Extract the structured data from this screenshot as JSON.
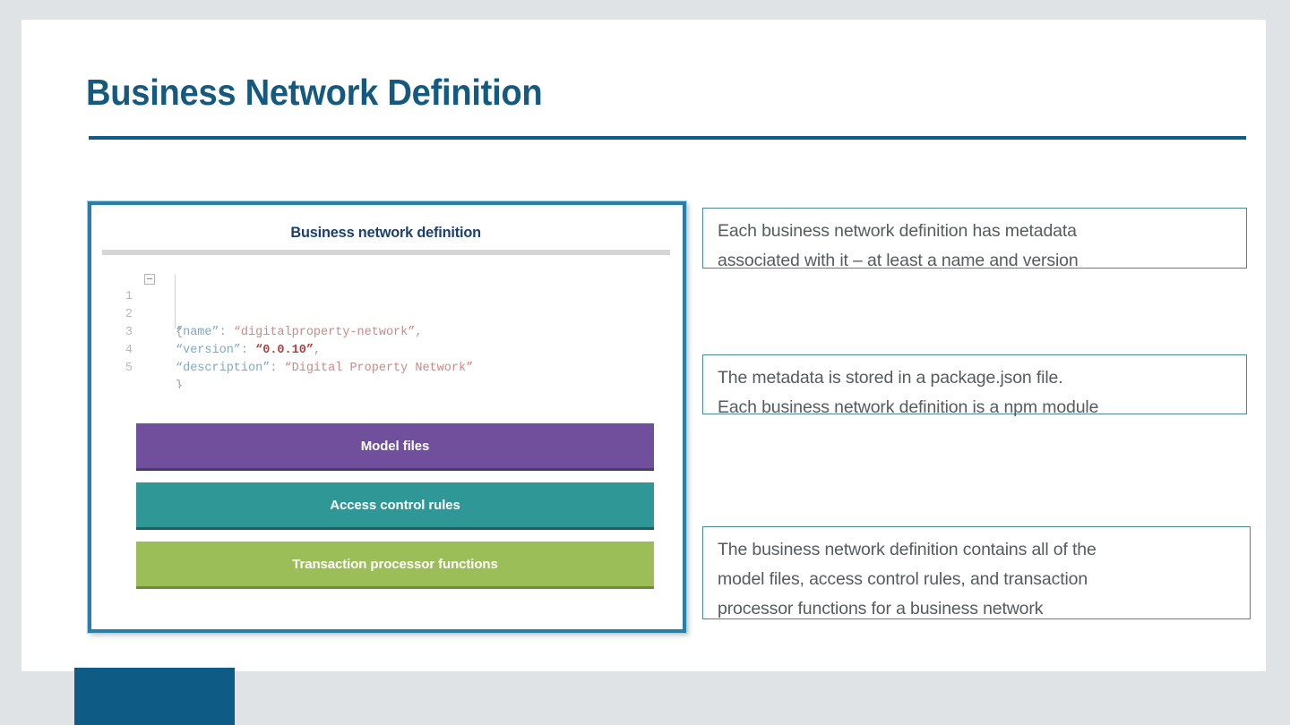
{
  "slide": {
    "title": "Business Network Definition",
    "background_color": "#dfe3e5",
    "surface_color": "#ffffff",
    "accent_color": "#105a83",
    "footer_accent_color": "#0e5b86"
  },
  "diagram": {
    "frame_border_color": "#2a7fa8",
    "card_header": "Business network definition",
    "code": {
      "language": "json",
      "line_numbers": [
        "1",
        "2",
        "3",
        "4",
        "5"
      ],
      "fold_icon": "collapse-minus-icon",
      "lines": [
        {
          "n": "1",
          "open_brace": "{"
        },
        {
          "n": "2",
          "key": "“name”",
          "colon": ": ",
          "value": "“digitalproperty-network”",
          "comma": ","
        },
        {
          "n": "3",
          "key": "“version”",
          "colon": ": ",
          "value": "“0.0.10”",
          "comma": ","
        },
        {
          "n": "4",
          "key": "“description”",
          "colon": ": ",
          "value": "“Digital Property Network”",
          "comma": ""
        },
        {
          "n": "5",
          "close_brace": "}"
        }
      ],
      "key_color": "#7fa8c6",
      "string_color": "#c98a86",
      "version_color": "#b0413e"
    },
    "bars": [
      {
        "label": "Model files",
        "color": "#70509c"
      },
      {
        "label": "Access control rules",
        "color": "#2f9796"
      },
      {
        "label": "Transaction processor functions",
        "color": "#9cbe58"
      }
    ]
  },
  "callouts": [
    {
      "line1": "Each business network definition has metadata",
      "line2": "associated with it – at least a name and version",
      "line3": ""
    },
    {
      "line1": "The metadata is stored in a package.json file.",
      "line2": "Each business network definition is a npm module",
      "line3": ""
    },
    {
      "line1": "The business network definition contains all of the",
      "line2": "model files, access control rules, and transaction",
      "line3": "processor functions for a business network"
    }
  ]
}
